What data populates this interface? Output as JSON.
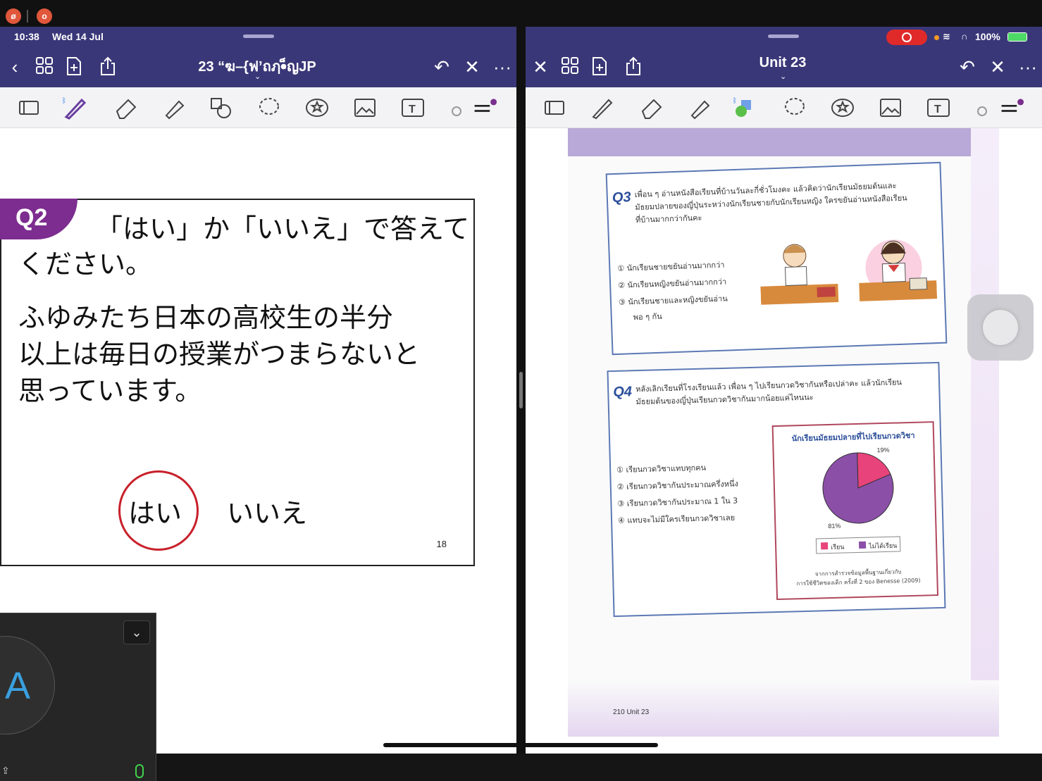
{
  "status": {
    "time": "10:38",
    "date": "Wed 14 Jul",
    "battery": "100%"
  },
  "left_app": {
    "title": "23 “ฆ–{ฟ’ถฦ•็ญJP",
    "slide": {
      "badge": "Q2",
      "question_line1": "「はい」か「いいえ」で答えて",
      "question_line2": "ください。",
      "statement_line1": "ふゆみたち日本の高校生の半分",
      "statement_line2": "以上は毎日の授業がつまらないと",
      "statement_line3": "思っています。",
      "answer_yes": "はい",
      "answer_no": "いいえ",
      "page_number": "18"
    }
  },
  "video_tile": {
    "avatar_letter": "A"
  },
  "right_app": {
    "title": "Unit 23",
    "book": {
      "q3_label": "Q3",
      "q3_line1": "เพื่อน ๆ อ่านหนังสือเรียนที่บ้านวันละกี่ชั่วโมงคะ แล้วคิดว่านักเรียนมัธยมต้นและ",
      "q3_line2": "มัธยมปลายของญี่ปุ่นระหว่างนักเรียนชายกับนักเรียนหญิง ใครขยันอ่านหนังสือเรียน",
      "q3_line3": "ที่บ้านมากกว่ากันคะ",
      "q3_options": [
        "① นักเรียนชายขยันอ่านมากกว่า",
        "② นักเรียนหญิงขยันอ่านมากกว่า",
        "③ นักเรียนชายและหญิงขยันอ่าน",
        "พอ ๆ กัน"
      ],
      "q4_label": "Q4",
      "q4_line1": "หลังเลิกเรียนที่โรงเรียนแล้ว เพื่อน ๆ ไปเรียนกวดวิชากันหรือเปล่าคะ แล้วนักเรียน",
      "q4_line2": "มัธยมต้นของญี่ปุ่นเรียนกวดวิชากันมากน้อยแค่ไหนนะ",
      "q4_options": [
        "① เรียนกวดวิชาแทบทุกคน",
        "② เรียนกวดวิชากันประมาณครึ่งหนึ่ง",
        "③ เรียนกวดวิชากันประมาณ 1 ใน 3",
        "④ แทบจะไม่มีใครเรียนกวดวิชาเลย"
      ],
      "chart_title": "นักเรียนมัธยมปลายที่ไปเรียนกวดวิชา",
      "legend_a": "เรียน",
      "legend_b": "ไม่ได้เรียน",
      "label_a": "19%",
      "label_b": "81%",
      "source_line1": "จากการสำรวจข้อมูลพื้นฐานเกี่ยวกับ",
      "source_line2": "การใช้ชีวิตของเด็ก ครั้งที่ 2 ของ Benesse (2009)",
      "footer": "210  Unit 23"
    }
  },
  "chart_data": {
    "type": "pie",
    "title": "นักเรียนมัธยมปลายที่ไปเรียนกวดวิชา",
    "categories": [
      "เรียน",
      "ไม่ได้เรียน"
    ],
    "values": [
      19,
      81
    ],
    "colors": [
      "#e8437a",
      "#8b4fa8"
    ],
    "legend": "bottom"
  },
  "colors": {
    "toolbar_bg": "#3a3778",
    "badge_purple": "#7d2d8f",
    "circle_red": "#c8202a"
  }
}
